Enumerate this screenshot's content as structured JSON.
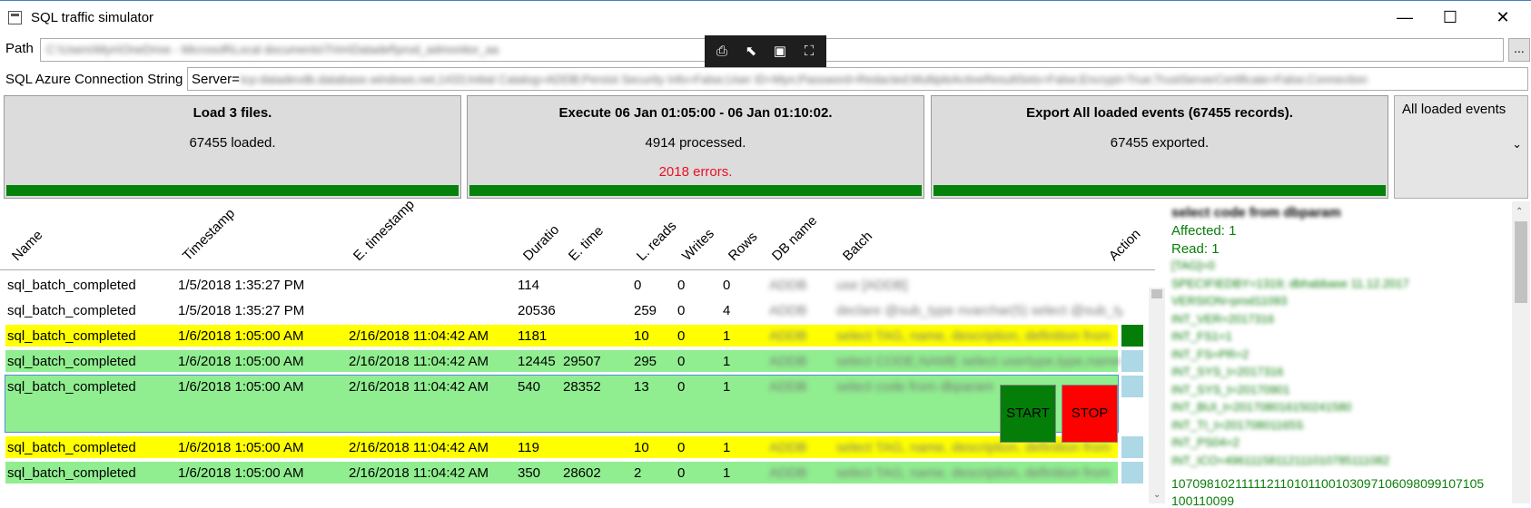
{
  "window": {
    "title": "SQL traffic simulator",
    "minimize": "—",
    "maximize": "☐",
    "close": "✕"
  },
  "path": {
    "label": "Path",
    "value": "C:\\Users\\Myn\\OneDrive - Microsoft\\Local documents\\Trim\\Datadef\\prod_admonitor_aa",
    "browse": "..."
  },
  "conn": {
    "label": "SQL Azure Connection String",
    "prefix": "Server=",
    "value": "tcp:datadevdb.database.windows.net,1433;Initial Catalog=ADDB;Persist Security Info=False;User ID=Myn;Password=Redacted;MultipleActiveResultSets=False;Encrypt=True;TrustServerCertificate=False;Connection"
  },
  "panels": [
    {
      "title": "Load 3 files.",
      "line": "67455 loaded.",
      "error": "",
      "progress": 1.0
    },
    {
      "title": "Execute 06 Jan 01:05:00 - 06 Jan 01:10:02.",
      "line": "4914 processed.",
      "error": "2018 errors.",
      "progress": 1.0
    },
    {
      "title": "Export All loaded events (67455 records).",
      "line": "67455 exported.",
      "error": "",
      "progress": 1.0
    }
  ],
  "select": {
    "value": "All loaded events"
  },
  "columns": [
    "Name",
    "Timestamp",
    "E. timestamp",
    "Duratio",
    "E. time",
    "L. reads",
    "Writes",
    "Rows",
    "DB name",
    "Batch",
    "Action"
  ],
  "rows": [
    {
      "name": "sql_batch_completed",
      "ts": "1/5/2018 1:35:27 PM",
      "ets": "",
      "dur": "114",
      "etime": "",
      "lreads": "0",
      "writes": "0",
      "rows": "0",
      "db": "ADDB",
      "batch": "use [ADDB]",
      "bg": "#ffffff"
    },
    {
      "name": "sql_batch_completed",
      "ts": "1/5/2018 1:35:27 PM",
      "ets": "",
      "dur": "20536",
      "etime": "",
      "lreads": "259",
      "writes": "0",
      "rows": "4",
      "db": "ADDB",
      "batch": "declare @sub_type nvarchar(5) select @sub_ty",
      "bg": "#ffffff"
    },
    {
      "name": "sql_batch_completed",
      "ts": "1/6/2018 1:05:00 AM",
      "ets": "2/16/2018 11:04:42 AM",
      "dur": "1181",
      "etime": "",
      "lreads": "10",
      "writes": "0",
      "rows": "1",
      "db": "ADDB",
      "batch": "select TAG, name, description, definition from",
      "bg": "#ffff00"
    },
    {
      "name": "sql_batch_completed",
      "ts": "1/6/2018 1:05:00 AM",
      "ets": "2/16/2018 11:04:42 AM",
      "dur": "12445",
      "etime": "29507",
      "lreads": "295",
      "writes": "0",
      "rows": "1",
      "db": "ADDB",
      "batch": "select CODE,NAME select usertype,type,name",
      "bg": "#90ee90"
    },
    {
      "name": "sql_batch_completed",
      "ts": "1/6/2018 1:05:00 AM",
      "ets": "2/16/2018 11:04:42 AM",
      "dur": "540",
      "etime": "28352",
      "lreads": "13",
      "writes": "0",
      "rows": "1",
      "db": "ADDB",
      "batch": "select code from dbparam",
      "bg": "#90ee90"
    },
    {
      "name": "sql_batch_completed",
      "ts": "1/6/2018 1:05:00 AM",
      "ets": "2/16/2018 11:04:42 AM",
      "dur": "119",
      "etime": "",
      "lreads": "10",
      "writes": "0",
      "rows": "1",
      "db": "ADDB",
      "batch": "select TAG, name, description, definition from",
      "bg": "#ffff00"
    },
    {
      "name": "sql_batch_completed",
      "ts": "1/6/2018 1:05:00 AM",
      "ets": "2/16/2018 11:04:42 AM",
      "dur": "350",
      "etime": "28602",
      "lreads": "2",
      "writes": "0",
      "rows": "1",
      "db": "ADDB",
      "batch": "select TAG, name, description, definition from",
      "bg": "#90ee90"
    }
  ],
  "actions": {
    "start": "START",
    "stop": "STOP"
  },
  "detail": {
    "heading": "select code from dbparam",
    "affected": "Affected: 1",
    "read": "Read: 1",
    "blurred": [
      "[TAG]=0",
      "SPECIFIEDBY=1319; dbhabbase 11.12.2017",
      "VERSION=prod11093",
      "INT_VER=2017316",
      "INT_FS1=1",
      "INT_FS=PR=2",
      "INT_SYS_t=2017316",
      "INT_SYS_t=20170901",
      "INT_BUI_t=201708016150241580",
      "INT_TI_t=20170801165S",
      "INT_PS04=2",
      "INT_ICO=49611158112111010785111082"
    ],
    "tail1": "107098102111112110101100103097106098099107105",
    "tail2": "100110099"
  }
}
